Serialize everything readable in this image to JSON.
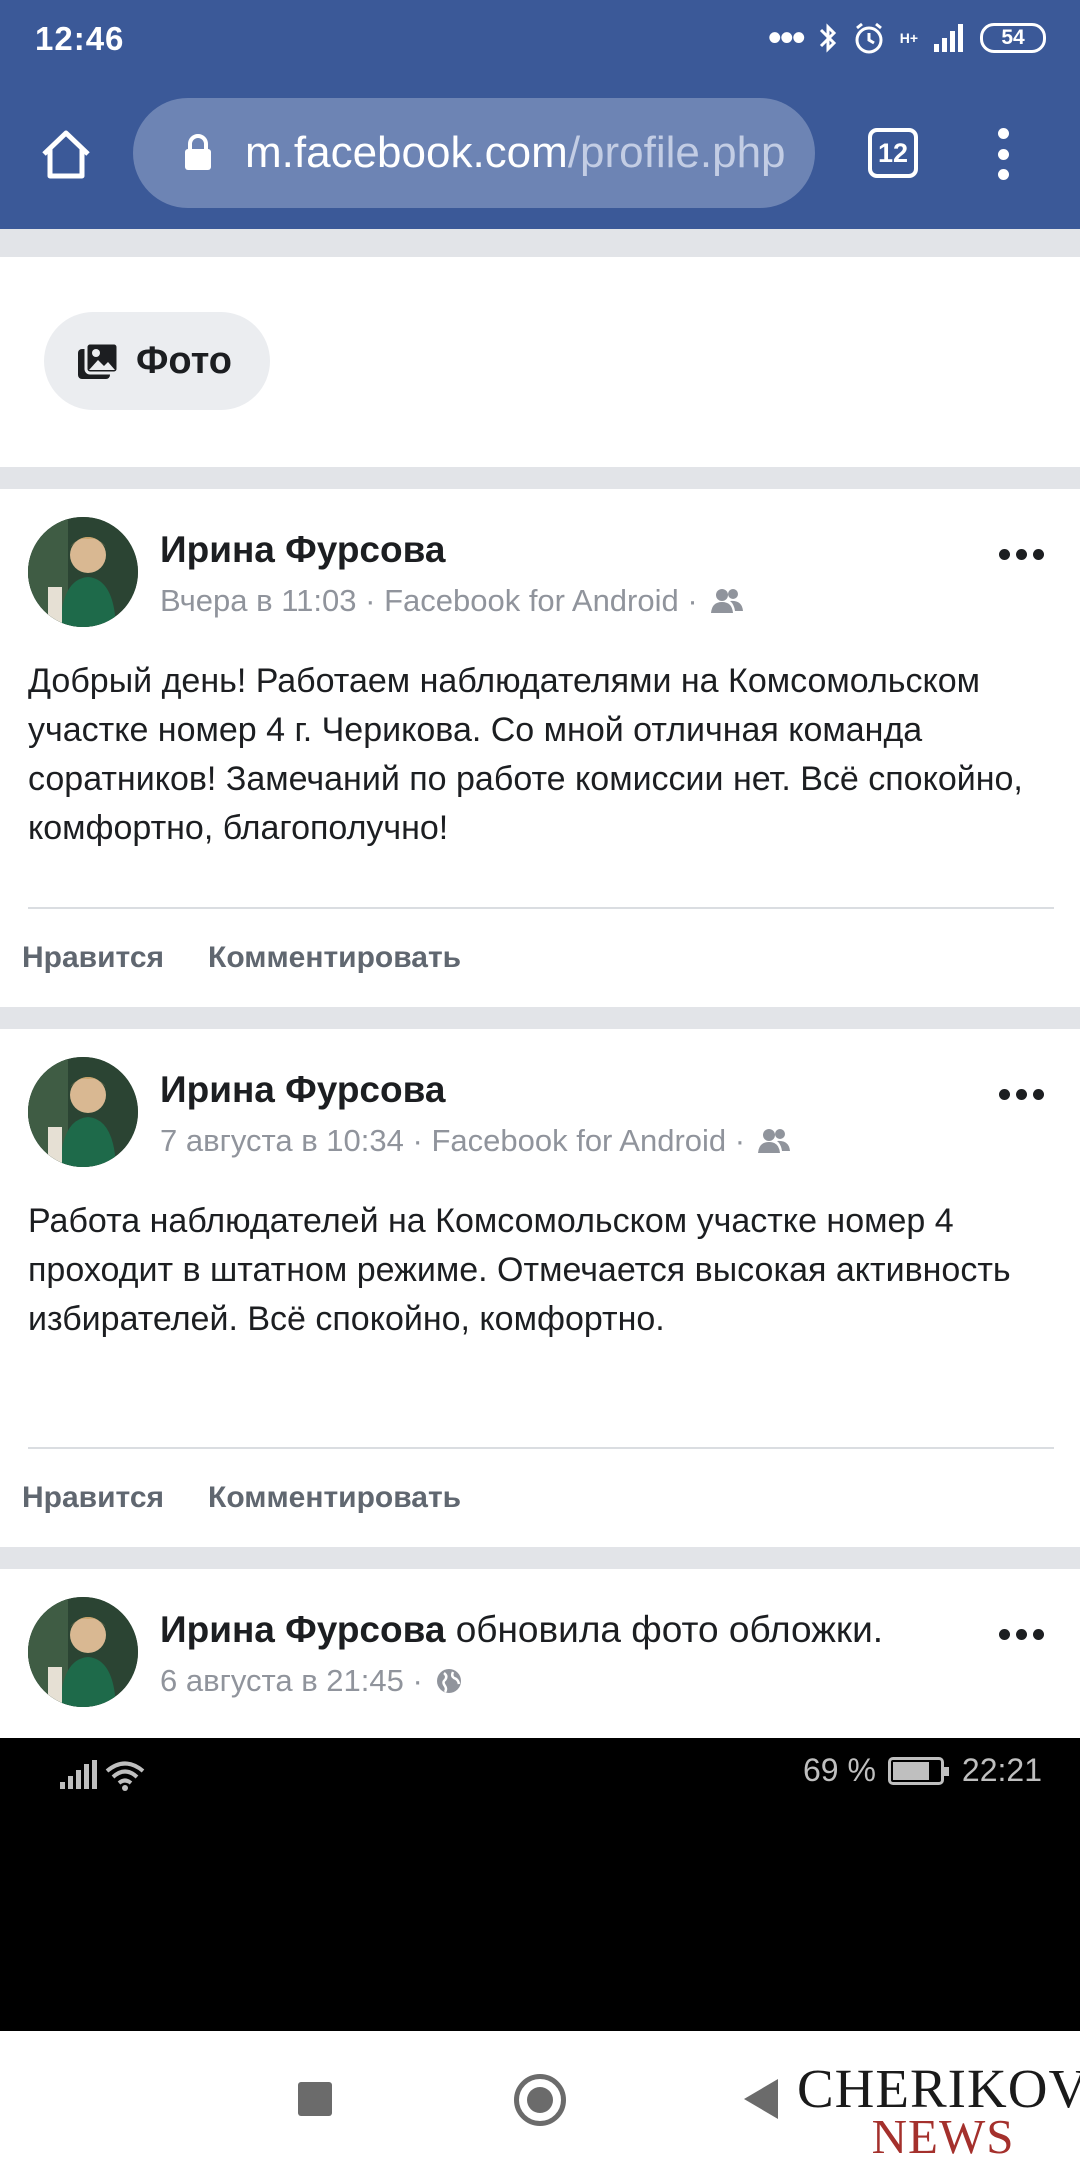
{
  "status_bar": {
    "time": "12:46",
    "network": "H+",
    "battery": "54"
  },
  "browser": {
    "url_host": "m.facebook.com",
    "url_path": "/profile.php",
    "tab_count": "12"
  },
  "composer": {
    "photo_label": "Фото"
  },
  "posts": [
    {
      "author": "Ирина Фурсова",
      "action": "",
      "time": "Вчера в 11:03",
      "source": "Facebook for Android",
      "privacy_icon": "friends-icon",
      "text": "Добрый день! Работаем наблюдателями на Комсомольском участке номер 4 г. Черикова. Со мной отличная команда соратников! Замечаний по работе комиссии нет. Всё спокойно, комфортно, благополучно!",
      "like_label": "Нравится",
      "comment_label": "Комментировать"
    },
    {
      "author": "Ирина Фурсова",
      "action": "",
      "time": "7 августа в 10:34",
      "source": "Facebook for Android",
      "privacy_icon": "friends-icon",
      "text": "Работа наблюдателей на Комсомольском участке номер 4 проходит в штатном режиме. Отмечается высокая активность избирателей. Всё спокойно, комфортно.",
      "like_label": "Нравится",
      "comment_label": "Комментировать"
    },
    {
      "author": "Ирина Фурсова",
      "action": "обновила фото обложки.",
      "time": "6 августа в 21:45",
      "source": "",
      "privacy_icon": "globe-icon"
    }
  ],
  "inner_status": {
    "battery_percent": "69 %",
    "time": "22:21"
  },
  "watermark": {
    "line1": "CHERIKOV",
    "line2": "NEWS"
  },
  "colors": {
    "facebook_blue": "#3b5998",
    "url_box": "#6d84b4",
    "watermark_red": "#a4302c"
  }
}
